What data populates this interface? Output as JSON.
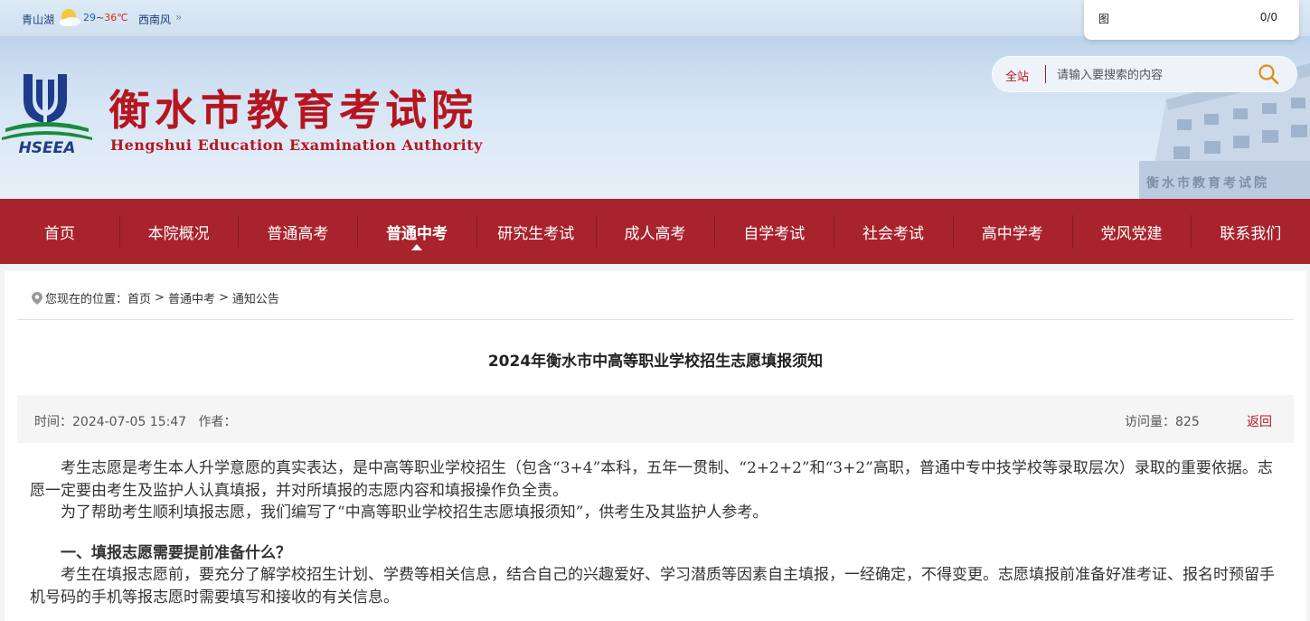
{
  "weather": {
    "location": "青山湖",
    "temp_low": "29",
    "temp_sep": "~",
    "temp_high": "36℃",
    "wind": "西南风",
    "more": "»",
    "icon": "sun-cloud-icon"
  },
  "find": {
    "label": "图",
    "count": "0/0"
  },
  "header": {
    "logo_text": "HSEEA",
    "site_name": "衡水市教育考试院",
    "site_name_en": "Hengshui Education Examination Authority",
    "building_sign": "衡水市教育考试院"
  },
  "search": {
    "scope": "全站",
    "placeholder": "请输入要搜索的内容",
    "icon": "search-icon",
    "accent": "#e58a1b"
  },
  "nav": {
    "items": [
      {
        "label": "首页"
      },
      {
        "label": "本院概况"
      },
      {
        "label": "普通高考"
      },
      {
        "label": "普通中考"
      },
      {
        "label": "研究生考试"
      },
      {
        "label": "成人高考"
      },
      {
        "label": "自学考试"
      },
      {
        "label": "社会考试"
      },
      {
        "label": "高中学考"
      },
      {
        "label": "党风党建"
      },
      {
        "label": "联系我们"
      }
    ],
    "active": "普通中考",
    "color": "#a8232c"
  },
  "breadcrumb": {
    "prefix": "您现在的位置：",
    "items": [
      "首页",
      "普通中考",
      "通知公告"
    ],
    "sep": ">"
  },
  "article": {
    "title": "2024年衡水市中高等职业学校招生志愿填报须知",
    "time": "时间：2024-07-05 15:47",
    "author": "作者：",
    "visits": "访问量：825",
    "back": "返回",
    "p1": "考生志愿是考生本人升学意愿的真实表达，是中高等职业学校招生（包含“3+4”本科，五年一贯制、“2+2+2”和“3+2”高职，普通中专中技学校等录取层次）录取的重要依据。志愿一定要由考生及监护人认真填报，并对所填报的志愿内容和填报操作负全责。",
    "p2": "为了帮助考生顺利填报志愿，我们编写了“中高等职业学校招生志愿填报须知”，供考生及其监护人参考。",
    "h1": "一、填报志愿需要提前准备什么？",
    "p3": "考生在填报志愿前，要充分了解学校招生计划、学费等相关信息，结合自己的兴趣爱好、学习潜质等因素自主填报，一经确定，不得变更。志愿填报前准备好准考证、报名时预留手机号码的手机等报志愿时需要填写和接收的有关信息。"
  }
}
